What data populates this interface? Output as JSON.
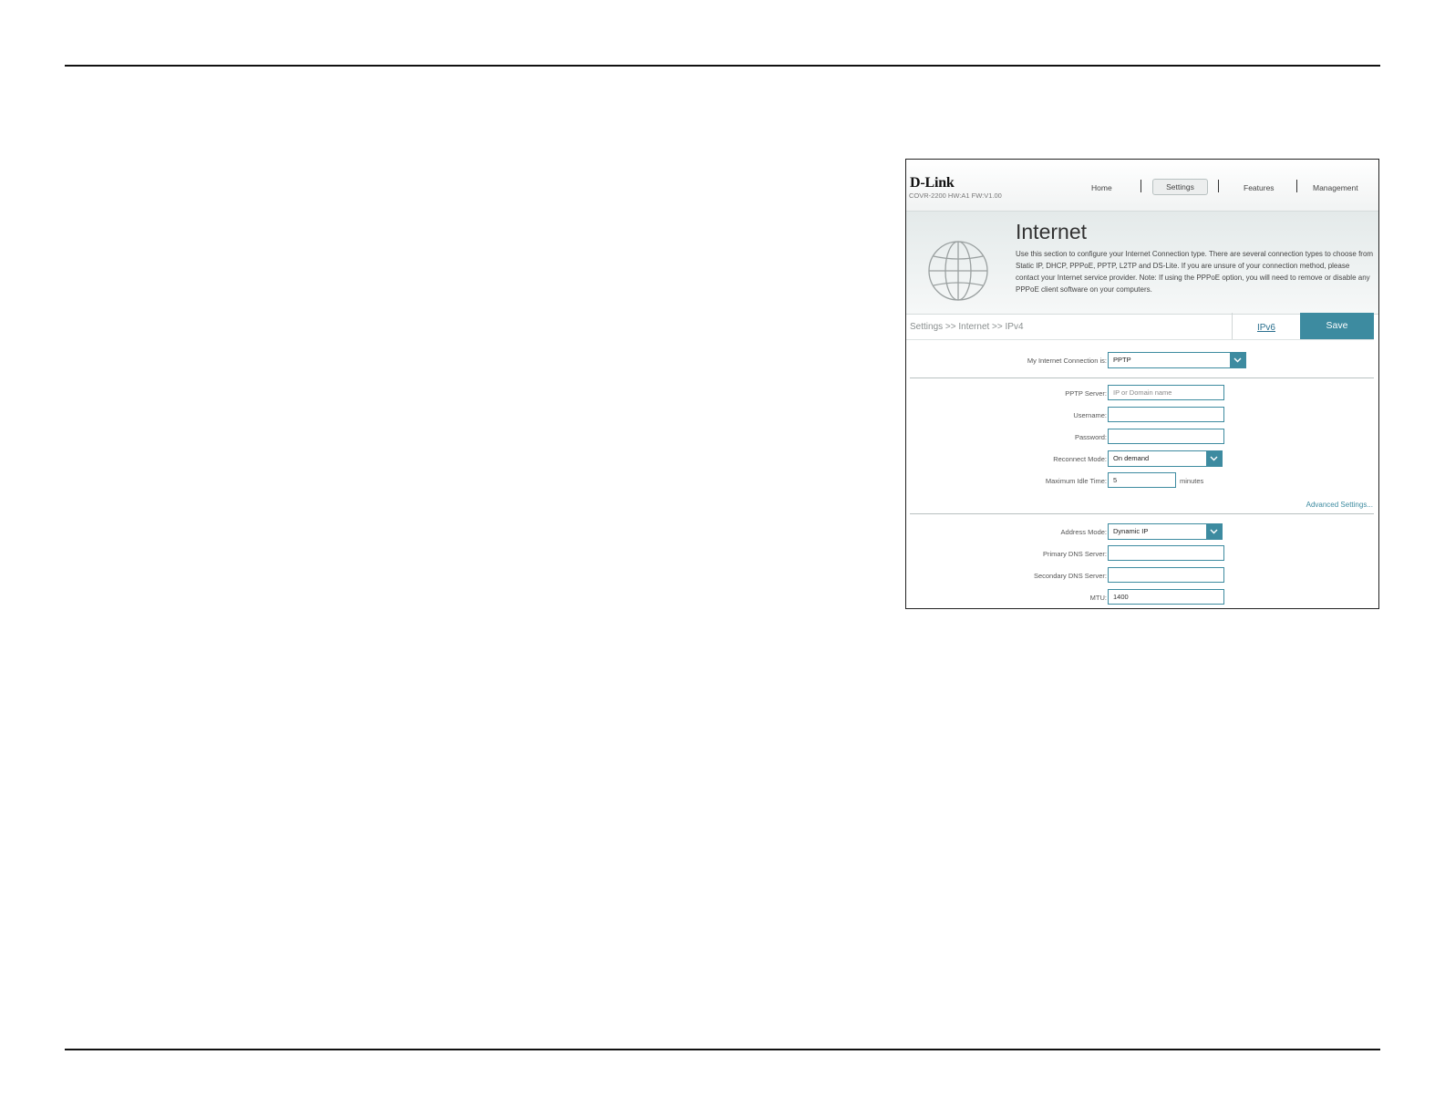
{
  "header": {
    "brand": "D-Link",
    "model": "COVR-2200 HW:A1 FW:V1.00",
    "nav": [
      {
        "label": "Home"
      },
      {
        "label": "Settings",
        "active": true
      },
      {
        "label": "Features"
      },
      {
        "label": "Management"
      }
    ]
  },
  "banner": {
    "icon": "globe-icon",
    "title": "Internet",
    "description": "Use this section to configure your Internet Connection type. There are several connection types to choose from Static IP, DHCP, PPPoE, PPTP, L2TP and DS-Lite. If you are unsure of your connection method, please contact your Internet service provider. Note: If using the PPPoE option, you will need to remove or disable any PPPoE client software on your computers."
  },
  "breadcrumb": "Settings >> Internet >> IPv4",
  "ipv6_link": "IPv6",
  "save_label": "Save",
  "form": {
    "connection": {
      "label": "My Internet Connection is:",
      "value": "PPTP"
    },
    "pptp_server": {
      "label": "PPTP Server:",
      "placeholder": "IP or Domain name",
      "value": ""
    },
    "username": {
      "label": "Username:",
      "value": ""
    },
    "password": {
      "label": "Password:",
      "value": ""
    },
    "reconnect_mode": {
      "label": "Reconnect Mode:",
      "value": "On demand"
    },
    "max_idle": {
      "label": "Maximum Idle Time:",
      "value": "5",
      "unit": "minutes"
    },
    "advanced_link": "Advanced Settings...",
    "address_mode": {
      "label": "Address Mode:",
      "value": "Dynamic IP"
    },
    "primary_dns": {
      "label": "Primary DNS Server:",
      "value": ""
    },
    "secondary_dns": {
      "label": "Secondary DNS Server:",
      "value": ""
    },
    "mtu": {
      "label": "MTU:",
      "value": "1400"
    }
  },
  "colors": {
    "accent": "#3d8ba0",
    "rule": "#111111"
  }
}
